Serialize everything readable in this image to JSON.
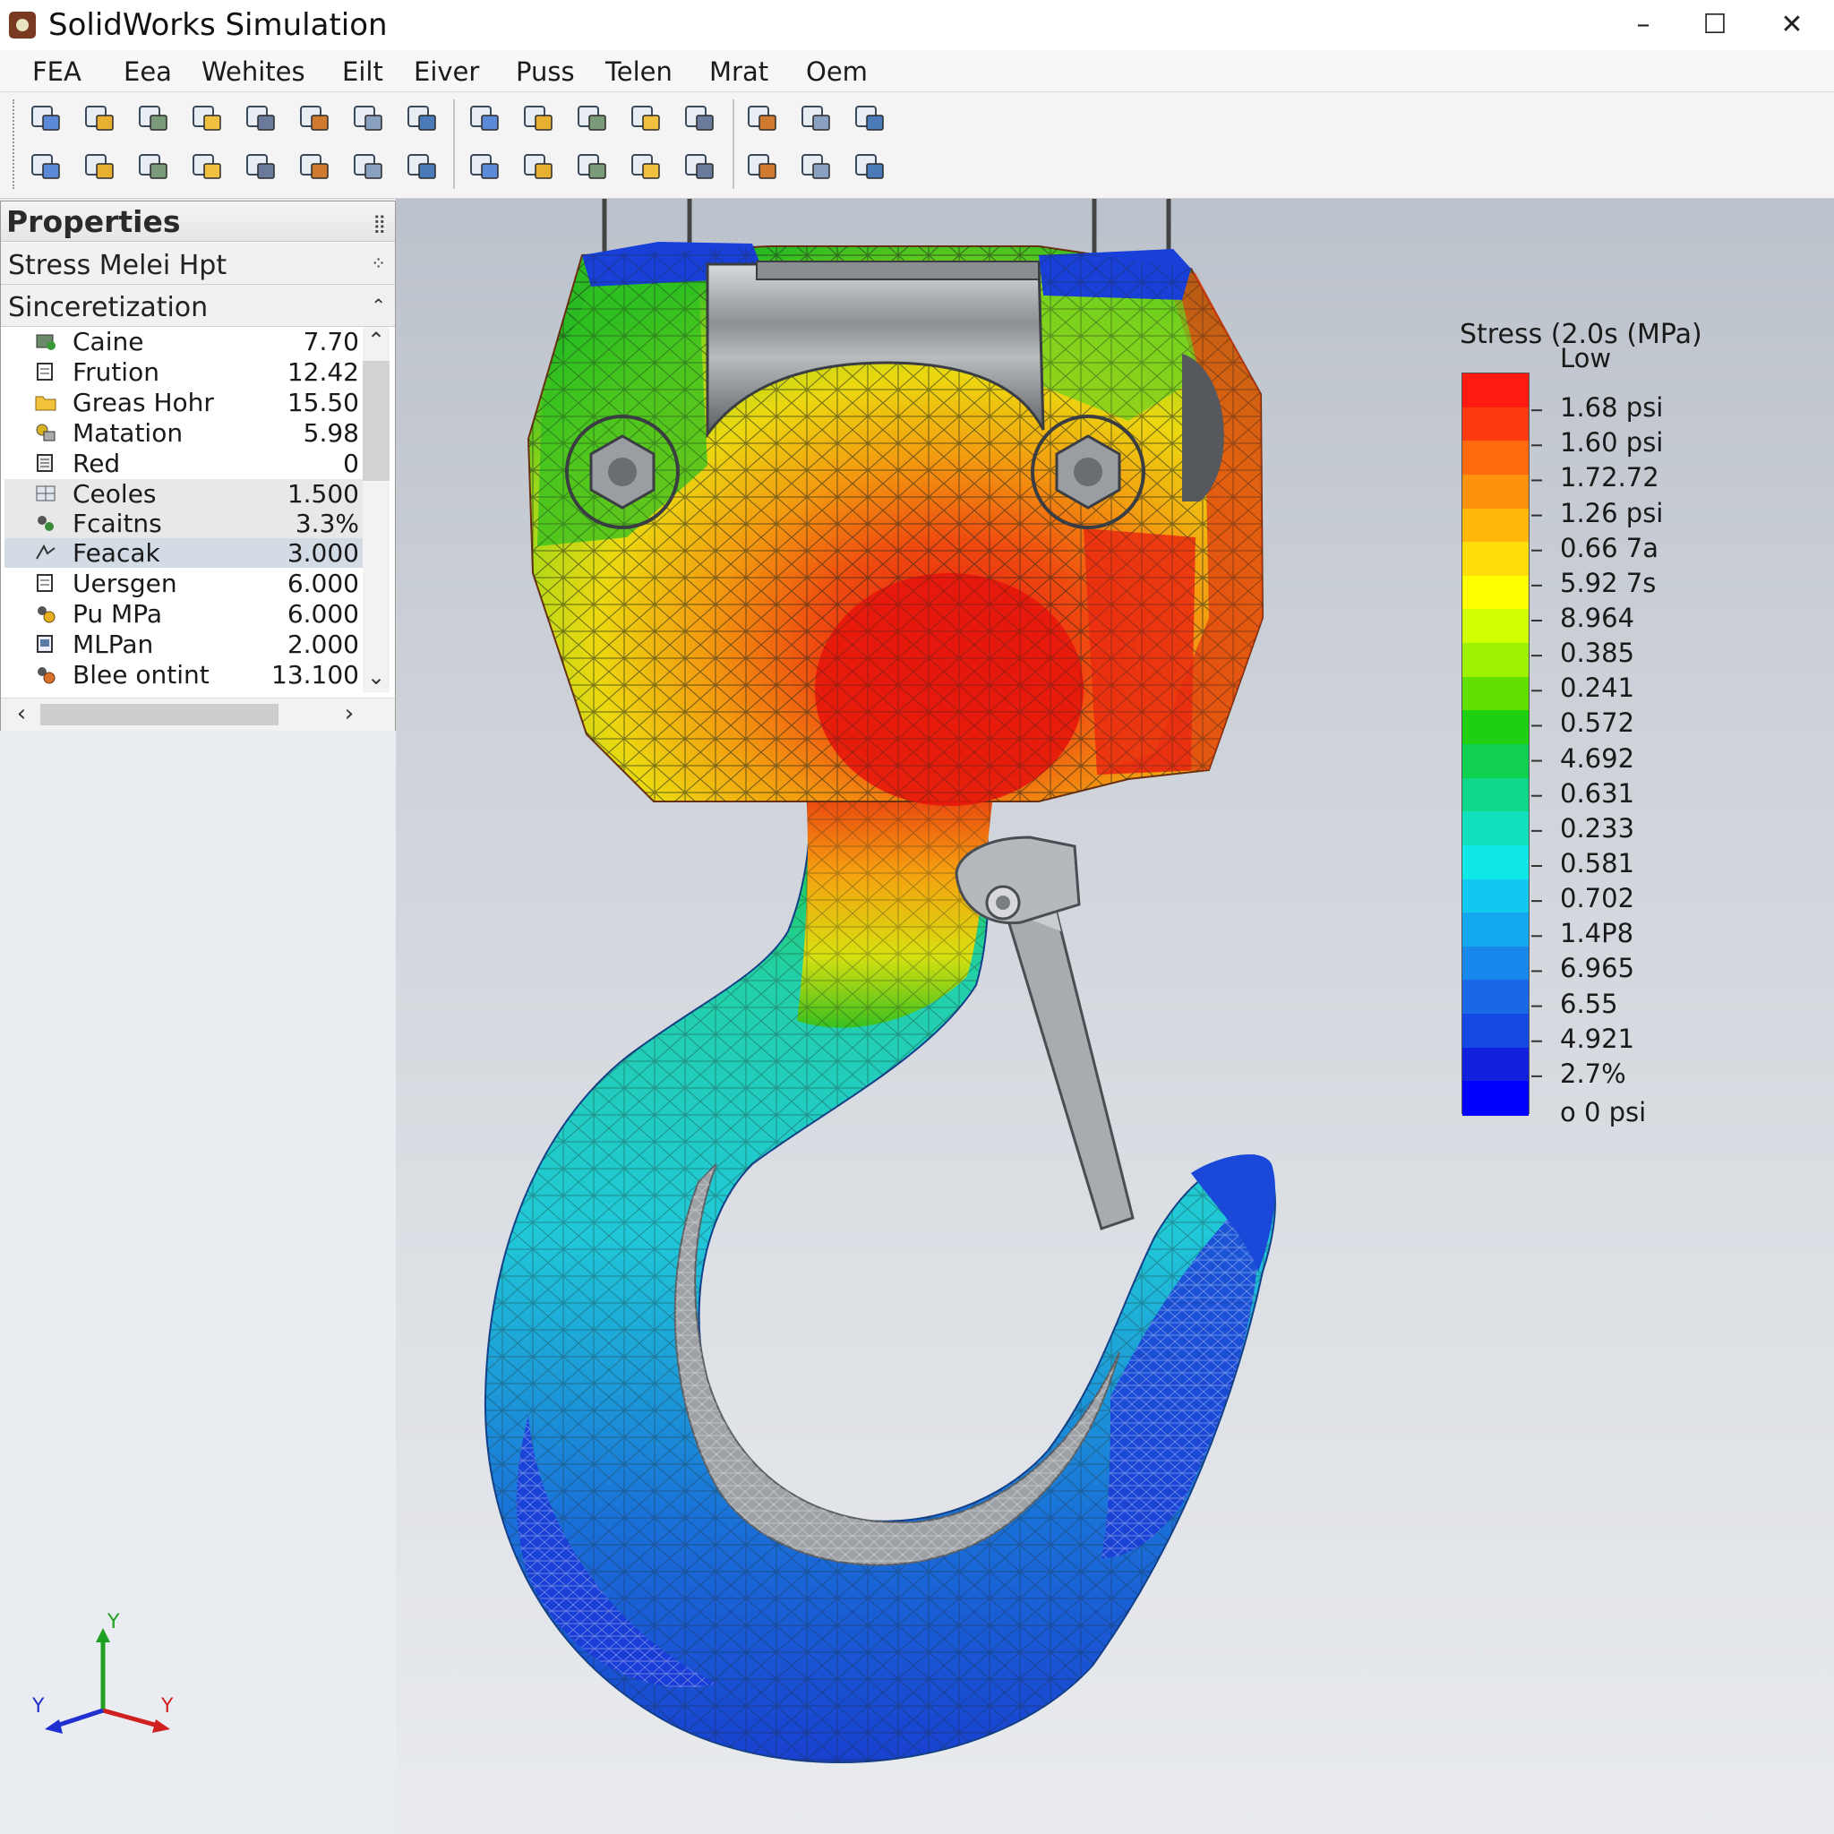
{
  "window": {
    "title": "SolidWorks Simulation",
    "minimize_glyph": "–",
    "maximize_glyph": "☐",
    "close_glyph": "✕"
  },
  "menu": [
    "FEA",
    "Eea",
    "Wehites",
    "Eilt",
    "Eiver",
    "Puss",
    "Telen",
    "Mrat",
    "Oem"
  ],
  "toolbar": {
    "row1_icons": [
      "new-study-icon",
      "mesh-icon",
      "material-icon",
      "folder-icon",
      "part-icon",
      "fixture-icon",
      "load-icon",
      "connector-icon",
      "force-icon",
      "explode-icon",
      "list-icon",
      "hammer-icon",
      "probe-icon",
      "measure-icon",
      "section-icon",
      "copy-icon"
    ],
    "row2_icons": [
      "shell-icon",
      "contact-icon",
      "report-icon",
      "compare-icon",
      "split-icon",
      "result-icon",
      "plot-icon",
      "animate-icon",
      "export-icon",
      "chart-icon",
      "clipboard-icon",
      "deform-icon",
      "wrench-icon",
      "options-icon",
      "settings-icon",
      "sphere-icon"
    ]
  },
  "panel": {
    "title": "Properties",
    "section1": "Stress Melei Hpt",
    "section2": "Sinceretization",
    "rows": [
      {
        "label": "Caine",
        "value": "7.70"
      },
      {
        "label": "Frution",
        "value": "12.42"
      },
      {
        "label": "Greas Hohr",
        "value": "15.50"
      },
      {
        "label": "Matation",
        "value": "5.98"
      },
      {
        "label": "Red",
        "value": "0"
      },
      {
        "label": "Ceoles",
        "value": "1.500"
      },
      {
        "label": "Fcaitns",
        "value": "3.3%"
      },
      {
        "label": "Feacak",
        "value": "3.000"
      },
      {
        "label": "Uersgen",
        "value": "6.000"
      },
      {
        "label": "Pu MPa",
        "value": "6.000"
      },
      {
        "label": "MLPan",
        "value": "2.000"
      },
      {
        "label": "Blee ontint",
        "value": "13.100"
      }
    ]
  },
  "legend": {
    "title": "Stress (2.0s (MPa)",
    "labels": [
      "Low",
      "1.68 psi",
      "1.60 psi",
      "1.72.72",
      "1.26 psi",
      "0.66 7a",
      "5.92 7s",
      "8.964",
      "0.385",
      "0.241",
      "0.572",
      "4.692",
      "0.631",
      "0.233",
      "0.581",
      "0.702",
      "1.4P8",
      "6.965",
      "6.55",
      "4.921",
      "2.7%",
      "o 0 psi"
    ],
    "colors": [
      "#ff1a12",
      "#ff3a10",
      "#ff6a0e",
      "#ff920c",
      "#ffb80a",
      "#ffdd08",
      "#ffff00",
      "#cfff00",
      "#9cf200",
      "#5fe000",
      "#1fd010",
      "#10d050",
      "#10d88a",
      "#10e0bc",
      "#10e8e8",
      "#10c8f0",
      "#14a8f0",
      "#1888ec",
      "#1868e8",
      "#1448e2",
      "#1020dc",
      "#0000ff"
    ]
  },
  "model": {
    "stress_colors": {
      "high": "#e81e10",
      "orange": "#f28a10",
      "yellow": "#eedc10",
      "green": "#34c018",
      "cyan": "#20d0c8",
      "blue": "#1840d8"
    }
  },
  "triad": {
    "x_label": "Y",
    "y_label": "Y",
    "z_label": "Y"
  }
}
